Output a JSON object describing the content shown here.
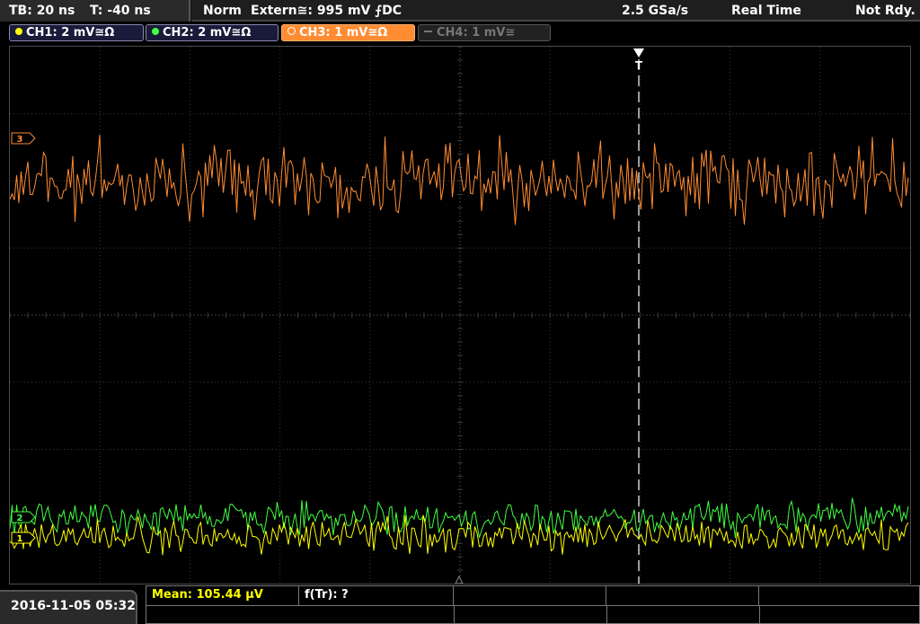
{
  "status": {
    "timebase": "TB: 20 ns",
    "trigger_time": "T: -40 ns",
    "mode": "Norm",
    "trigger_source": "Extern≅: 995 mV ⨍DC",
    "sample_rate": "2.5 GSa/s",
    "acquisition": "Real Time",
    "ready_state": "Not Rdy."
  },
  "channels": [
    {
      "label": "CH1: 2 mV≅Ω",
      "color": "#ffff00",
      "active": true
    },
    {
      "label": "CH2: 2 mV≅Ω",
      "color": "#40ff40",
      "active": true
    },
    {
      "label": "CH3: 1 mV≅Ω",
      "color": "#ff8c32",
      "active": true,
      "selected": true
    },
    {
      "label": "CH4: 1 mV≅",
      "color": "#666666",
      "active": false
    }
  ],
  "markers": {
    "ch3": "3",
    "ch2": "2",
    "ch1": "1",
    "trigger": "T"
  },
  "bottom": {
    "datetime": "2016-11-05 05:32",
    "mean_label": "Mean: 105.44 μV",
    "freq_label": "f(Tr): ?"
  },
  "colors": {
    "ch1": "#ffff00",
    "ch2": "#40ff40",
    "ch3": "#ff8c32",
    "grid": "#3a3a3a",
    "trigger_line": "#ffffff"
  }
}
